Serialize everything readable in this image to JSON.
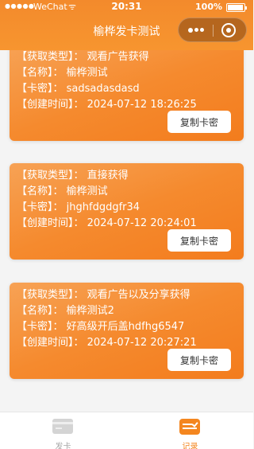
{
  "status_bar": {
    "signal": "●●●●●",
    "carrier": "WeChat",
    "wifi": "ᯤ",
    "time": "20:31",
    "battery": "100%"
  },
  "nav": {
    "title": "榆桦发卡测试"
  },
  "labels": {
    "type": "【获取类型】：",
    "name": "【名称】：",
    "key": "【卡密】：",
    "created": "【创建时间】："
  },
  "records": [
    {
      "type": "观看广告获得",
      "name": "榆桦测试",
      "key": "sadsadasdasd",
      "created": "2024-07-12 18:26:25",
      "copy_label": "复制卡密"
    },
    {
      "type": "直接获得",
      "name": "榆桦测试",
      "key": "jhghfdgdgfr34",
      "created": "2024-07-12 20:24:01",
      "copy_label": "复制卡密"
    },
    {
      "type": "观看广告以及分享获得",
      "name": "榆桦测试2",
      "key": "好高级开后盖hdfhg6547",
      "created": "2024-07-12 20:27:21",
      "copy_label": "复制卡密"
    }
  ],
  "tabbar": {
    "tabs": [
      {
        "label": "发卡",
        "icon": "card-icon",
        "active": false
      },
      {
        "label": "记录",
        "icon": "record-list-icon",
        "active": true
      }
    ]
  },
  "colors": {
    "brand": "#f58a2e",
    "active_tab": "#f4861f",
    "inactive_tab": "#a8a8a8"
  }
}
